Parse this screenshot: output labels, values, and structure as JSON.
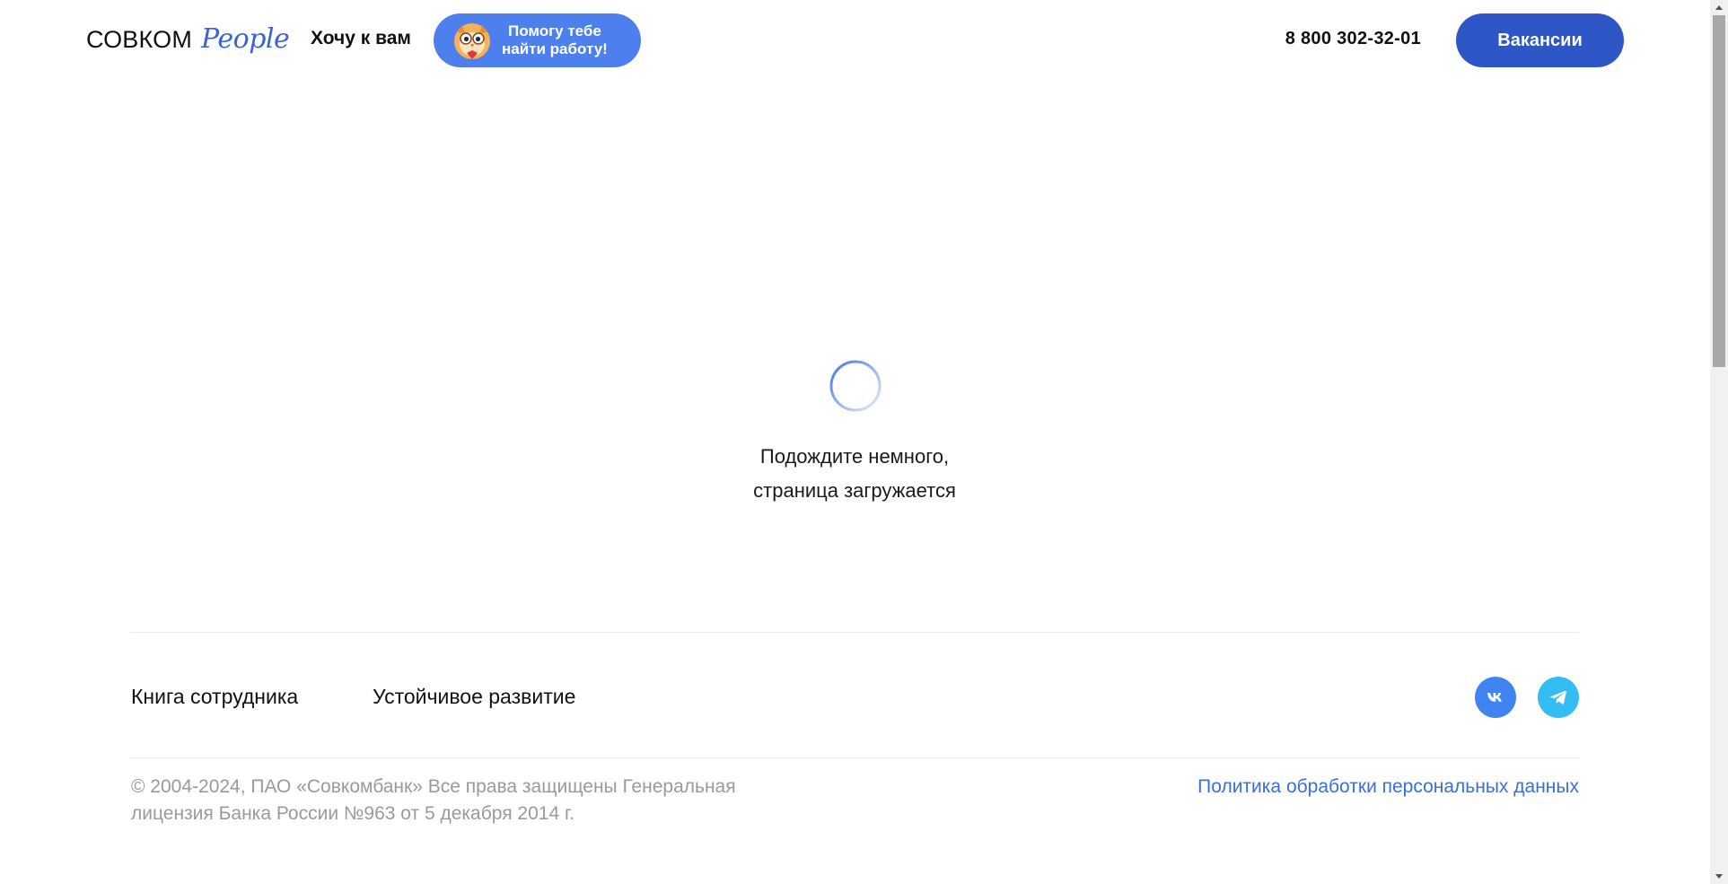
{
  "header": {
    "logo_main": "СОВКОМ",
    "logo_sub": "People",
    "nav_want": "Хочу к вам",
    "assistant_line1": "Помогу тебе",
    "assistant_line2": "найти работу!",
    "phone": "8 800 302-32-01",
    "vacancies_label": "Вакансии"
  },
  "loader": {
    "line1": "Подождите немного,",
    "line2": "страница загружается"
  },
  "footer": {
    "links": [
      {
        "label": "Книга сотрудника"
      },
      {
        "label": "Устойчивое развитие"
      }
    ],
    "social": [
      {
        "icon": "vk-icon",
        "color": "#3f84f0"
      },
      {
        "icon": "telegram-icon",
        "color": "#33bdf2"
      }
    ],
    "copyright": "© 2004-2024, ПАО «Совкомбанк» Все права защищены Генеральная лицензия Банка России №963 от 5 декабря 2014 г.",
    "policy_link": "Политика обработки персональных данных"
  },
  "colors": {
    "accent": "#2e56c7",
    "assistant": "#4d80ec",
    "link": "#3a6fd8"
  }
}
